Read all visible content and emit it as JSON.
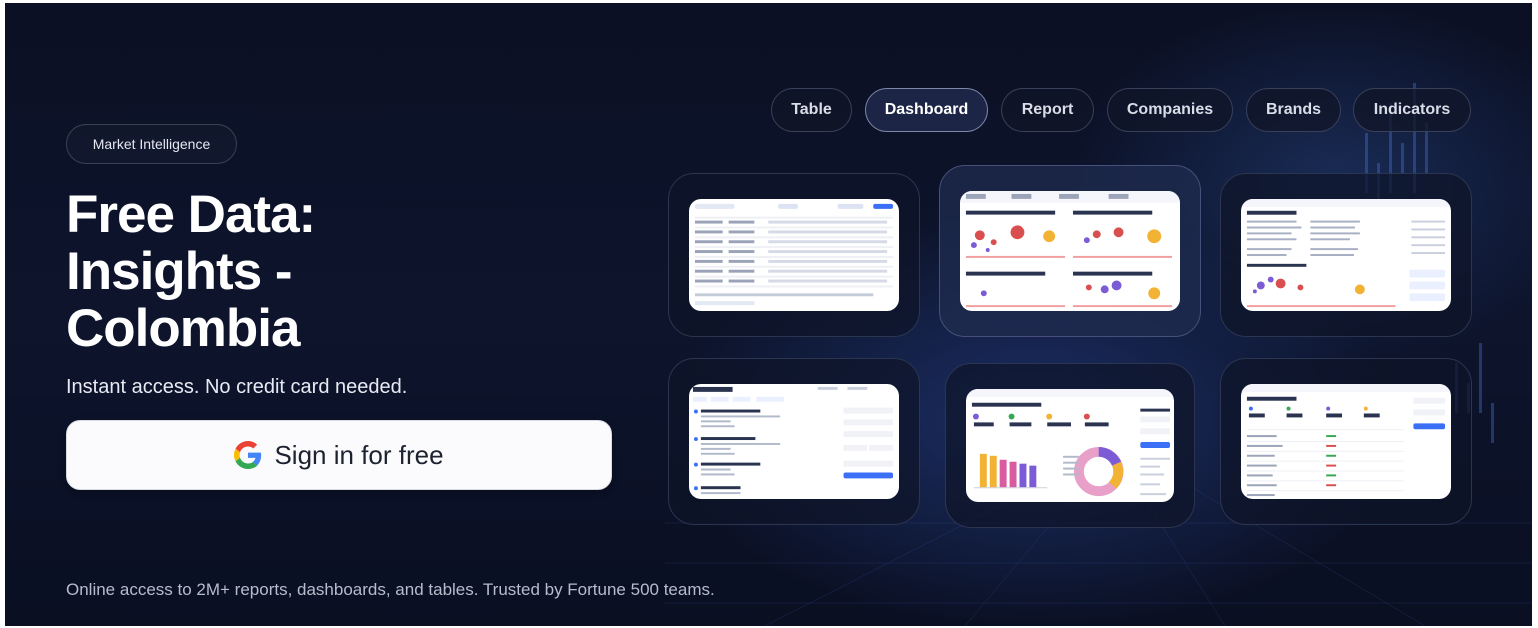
{
  "hero": {
    "badge": "Market Intelligence",
    "headline": [
      "Free Data:",
      "Insights -",
      "Colombia"
    ],
    "subtitle": "Instant access. No credit card needed.",
    "signin_label": "Sign in for free",
    "footnote": "Online access to 2M+ reports, dashboards, and tables. Trusted by Fortune 500 teams."
  },
  "tabs": [
    {
      "label": "Table",
      "active": false
    },
    {
      "label": "Dashboard",
      "active": true
    },
    {
      "label": "Report",
      "active": false
    },
    {
      "label": "Companies",
      "active": false
    },
    {
      "label": "Brands",
      "active": false
    },
    {
      "label": "Indicators",
      "active": false
    }
  ],
  "previews": [
    {
      "name": "table-preview"
    },
    {
      "name": "dashboard-preview"
    },
    {
      "name": "report-preview"
    },
    {
      "name": "companies-preview"
    },
    {
      "name": "brands-preview"
    },
    {
      "name": "indicators-preview"
    }
  ],
  "colors": {
    "background": "#0b1024",
    "accent": "#3b6ff5",
    "google_blue": "#4285F4",
    "google_red": "#EA4335",
    "google_yellow": "#FBBC05",
    "google_green": "#34A853"
  },
  "icons": {
    "signin": "google-g-icon"
  }
}
